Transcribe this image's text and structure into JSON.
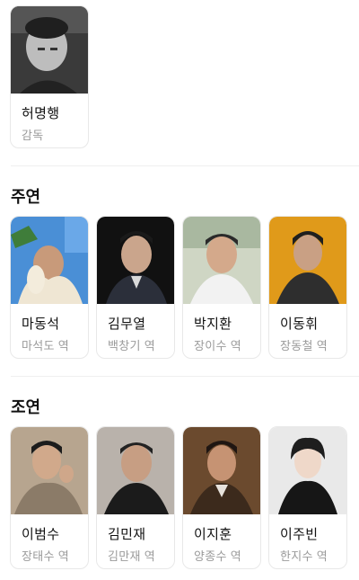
{
  "director": {
    "name": "허명행",
    "role": "감독"
  },
  "sections": [
    {
      "title": "주연",
      "cast": [
        {
          "name": "마동석",
          "role": "마석도 역"
        },
        {
          "name": "김무열",
          "role": "백창기 역"
        },
        {
          "name": "박지환",
          "role": "장이수 역"
        },
        {
          "name": "이동휘",
          "role": "장동철 역"
        }
      ]
    },
    {
      "title": "조연",
      "cast": [
        {
          "name": "이범수",
          "role": "장태수 역"
        },
        {
          "name": "김민재",
          "role": "김만재 역"
        },
        {
          "name": "이지훈",
          "role": "양종수 역"
        },
        {
          "name": "이주빈",
          "role": "한지수 역"
        }
      ]
    }
  ]
}
